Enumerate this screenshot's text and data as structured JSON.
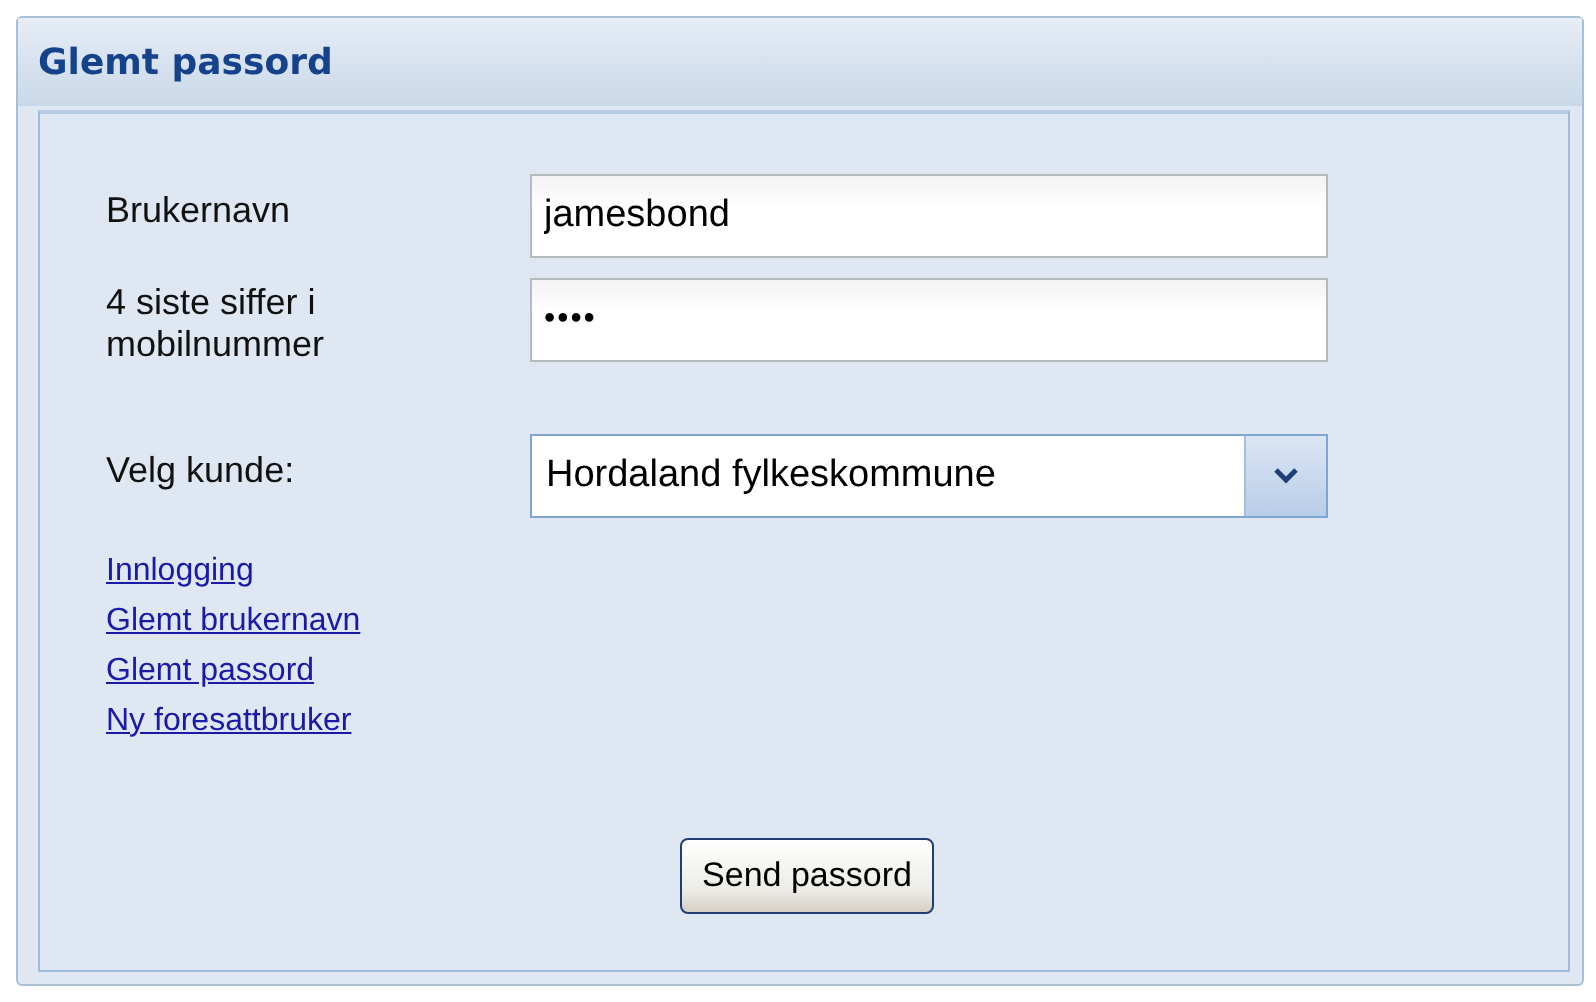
{
  "panel": {
    "title": "Glemt passord"
  },
  "fields": [
    {
      "label": "Brukernavn",
      "kind": "text",
      "value": "jamesbond"
    },
    {
      "label": "4 siste siffer i mobilnummer",
      "kind": "password",
      "value": "••••"
    },
    {
      "label": "Velg kunde:",
      "kind": "select",
      "value": "Hordaland fylkeskommune"
    }
  ],
  "links": [
    "Innlogging",
    "Glemt brukernavn",
    "Glemt passord",
    "Ny foresattbruker"
  ],
  "buttons": [
    "Send passord"
  ]
}
